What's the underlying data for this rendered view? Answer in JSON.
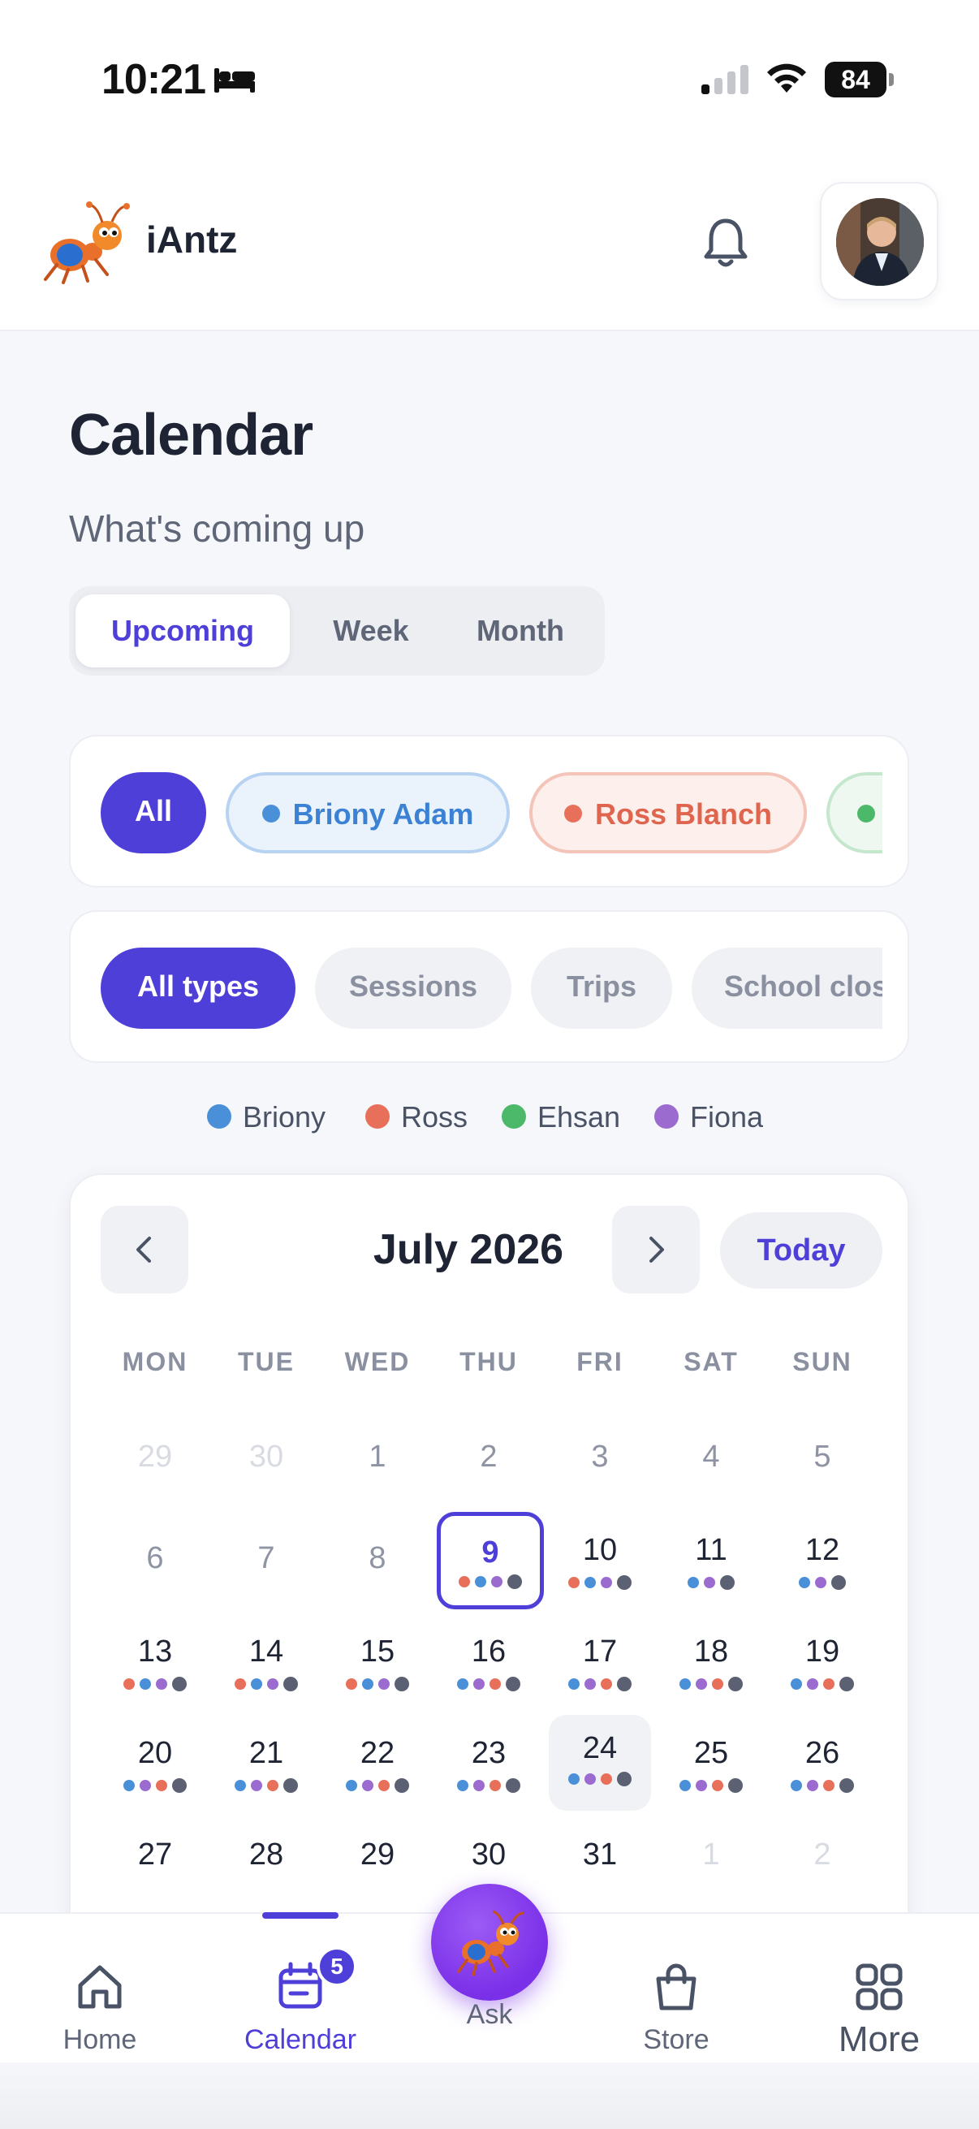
{
  "status_bar": {
    "time": "10:21",
    "battery": "84"
  },
  "header": {
    "app_name": "iAntz"
  },
  "page": {
    "title": "Calendar",
    "subtitle": "What's coming up"
  },
  "view_tabs": [
    {
      "label": "Upcoming",
      "active": true
    },
    {
      "label": "Week",
      "active": false
    },
    {
      "label": "Month",
      "active": false
    }
  ],
  "person_filters": [
    {
      "label": "All",
      "active": true
    },
    {
      "label": "Briony Adam",
      "color": "#4A90D9"
    },
    {
      "label": "Ross Blanch",
      "color": "#E8705A"
    },
    {
      "label": "",
      "color": "#4CB86A"
    }
  ],
  "type_filters": [
    {
      "label": "All types",
      "active": true
    },
    {
      "label": "Sessions"
    },
    {
      "label": "Trips"
    },
    {
      "label": "School clos"
    }
  ],
  "legend": [
    {
      "label": "Briony",
      "color": "#4A90D9"
    },
    {
      "label": "Ross",
      "color": "#E8705A"
    },
    {
      "label": "Ehsan",
      "color": "#4CB86A"
    },
    {
      "label": "Fiona",
      "color": "#9B6BD0"
    }
  ],
  "calendar": {
    "month_label": "July 2026",
    "today_label": "Today",
    "weekdays": [
      "MON",
      "TUE",
      "WED",
      "THU",
      "FRI",
      "SAT",
      "SUN"
    ],
    "rows": [
      [
        "29",
        "30",
        "1",
        "2",
        "3",
        "4",
        "5"
      ],
      [
        "6",
        "7",
        "8",
        "9",
        "10",
        "11",
        "12"
      ],
      [
        "13",
        "14",
        "15",
        "16",
        "17",
        "18",
        "19"
      ],
      [
        "20",
        "21",
        "22",
        "23",
        "24",
        "25",
        "26"
      ],
      [
        "27",
        "28",
        "29",
        "30",
        "31",
        "1",
        "2"
      ]
    ]
  },
  "tabbar": {
    "home": "Home",
    "calendar": "Calendar",
    "calendar_badge": "5",
    "ask": "Ask",
    "store": "Store",
    "more": "More"
  },
  "colors": {
    "accent": "#4F3FD9",
    "briony": "#4A90D9",
    "ross": "#E8705A",
    "ehsan": "#4CB86A",
    "fiona": "#9B6BD0",
    "gray_dot": "#5B6172"
  }
}
